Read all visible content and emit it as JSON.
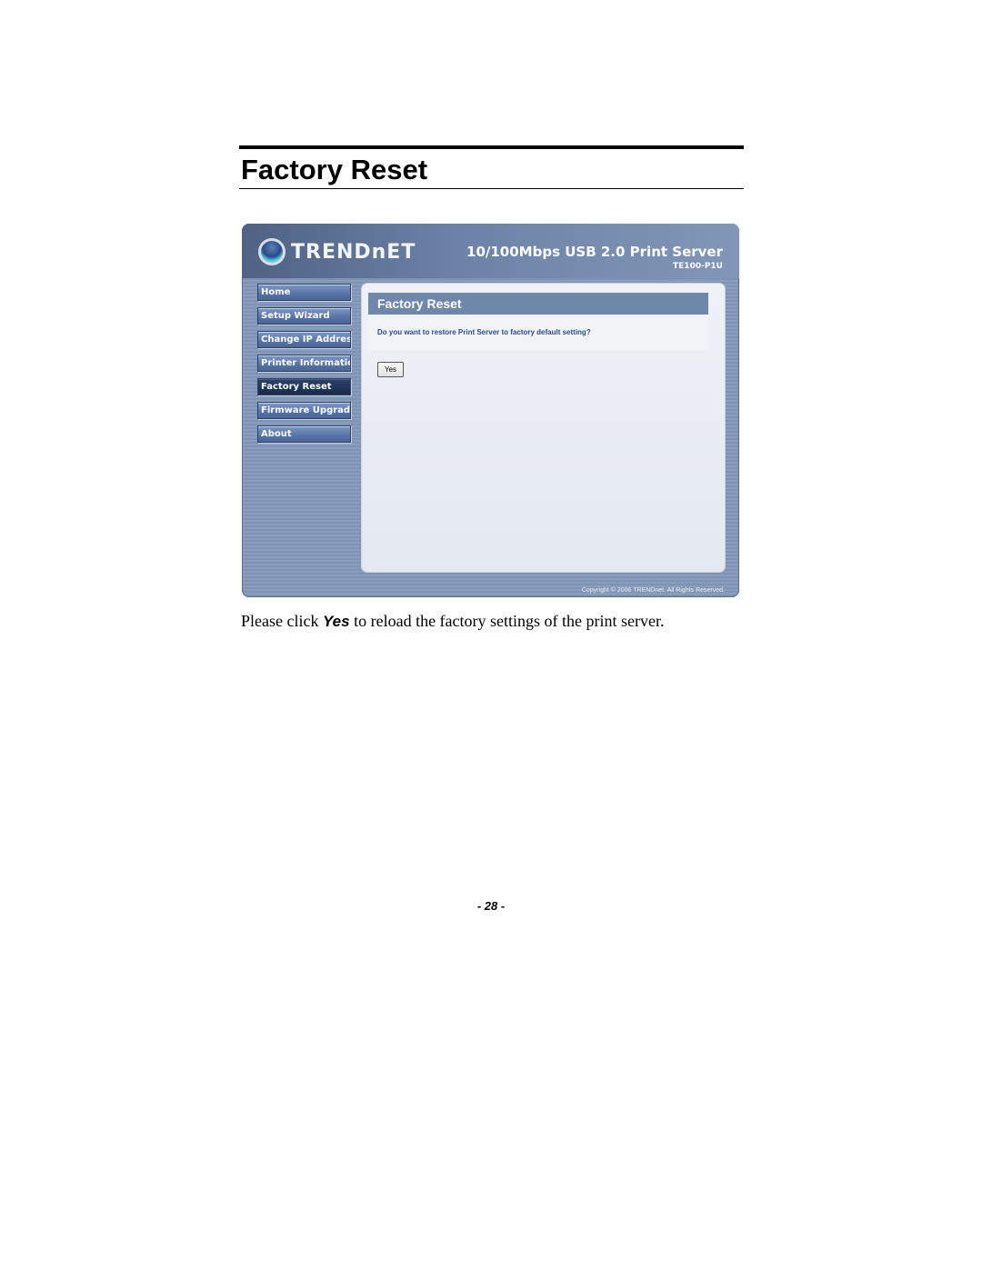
{
  "document": {
    "heading": "Factory Reset",
    "caption": {
      "before": "Please click ",
      "emphasis": "Yes",
      "after": " to reload the factory settings of the print server."
    },
    "page_number": "- 28 -"
  },
  "screenshot": {
    "brand": {
      "logo_icon": "globe-icon",
      "logo_text": "TRENDnET",
      "product_title": "10/100Mbps USB 2.0 Print Server",
      "product_model": "TE100-P1U"
    },
    "nav": {
      "items": [
        {
          "label": "Home",
          "active": false
        },
        {
          "label": "Setup Wizard",
          "active": false
        },
        {
          "label": "Change IP Address",
          "active": false
        },
        {
          "label": "Printer Information",
          "active": false
        },
        {
          "label": "Factory Reset",
          "active": true
        },
        {
          "label": "Firmware Upgrade",
          "active": false
        },
        {
          "label": "About",
          "active": false
        }
      ]
    },
    "panel": {
      "title": "Factory Reset",
      "question": "Do you want to restore Print Server to factory default setting?",
      "yes_label": "Yes"
    },
    "footer": {
      "copyright": "Copyright © 2006 TRENDnet. All Rights Reserved."
    },
    "colors": {
      "panel_title_bg": "#6f88aa",
      "question_text": "#2a4e8a",
      "active_nav_bg": "#1a2b4a"
    }
  }
}
